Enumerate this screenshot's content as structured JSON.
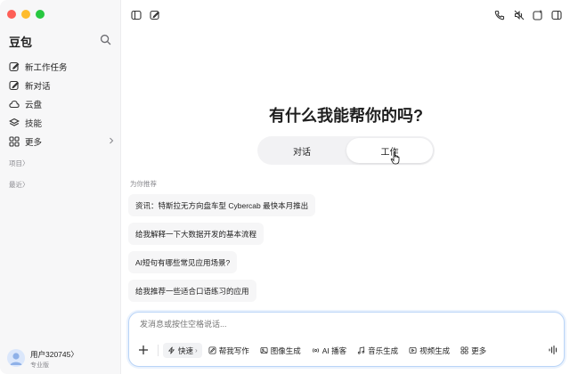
{
  "sidebar": {
    "brand": "豆包",
    "nav": [
      {
        "label": "新工作任务",
        "icon": "edit-task-icon"
      },
      {
        "label": "新对话",
        "icon": "new-chat-icon"
      },
      {
        "label": "云盘",
        "icon": "cloud-icon"
      },
      {
        "label": "技能",
        "icon": "layers-icon"
      },
      {
        "label": "更多",
        "icon": "grid-icon"
      }
    ],
    "projects_label": "项目〉",
    "recent_label": "最近〉",
    "user": {
      "name": "用户320745〉",
      "plan": "专业版"
    }
  },
  "main": {
    "title": "有什么我能帮你的吗?",
    "tabs": [
      {
        "label": "对话",
        "active": false
      },
      {
        "label": "工作",
        "active": true
      }
    ],
    "recommend_label": "为你推荐",
    "recommendations": [
      "资讯：特斯拉无方向盘车型 Cybercab 最快本月推出",
      "给我解释一下大数据开发的基本流程",
      "AI短句有哪些常见应用场景?",
      "给我推荐一些适合口语练习的应用"
    ]
  },
  "composer": {
    "placeholder": "发消息或按住空格说话...",
    "tools": [
      {
        "label": "快速",
        "icon": "bolt-icon"
      },
      {
        "label": "帮我写作",
        "icon": "write-icon"
      },
      {
        "label": "图像生成",
        "icon": "image-icon"
      },
      {
        "label": "AI 播客",
        "icon": "podcast-icon"
      },
      {
        "label": "音乐生成",
        "icon": "music-icon"
      },
      {
        "label": "视频生成",
        "icon": "video-icon"
      },
      {
        "label": "更多",
        "icon": "grid-icon"
      }
    ]
  },
  "colors": {
    "accent_border": "#b9d4f7",
    "sidebar_bg": "#f7f7f8",
    "traffic_red": "#fe5f57",
    "traffic_yellow": "#febc2e",
    "traffic_green": "#28c840"
  }
}
